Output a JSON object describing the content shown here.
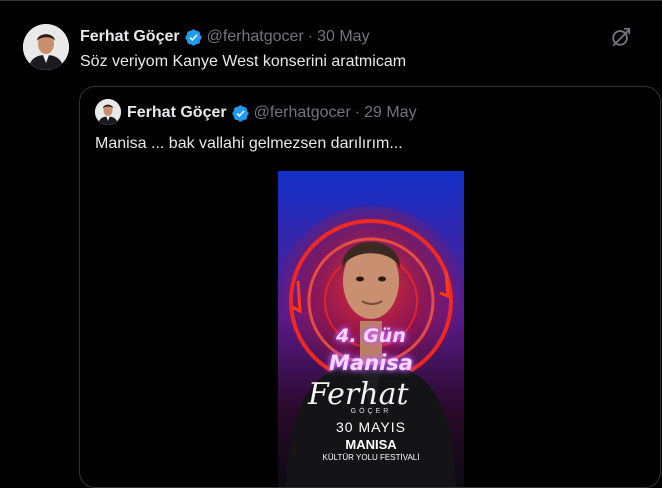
{
  "tweet": {
    "author_name": "Ferhat Göçer",
    "handle": "@ferhatgocer",
    "separator": "·",
    "date": "30 May",
    "text": "Söz veriyom Kanye West konserini aratmicam",
    "grok_icon": "grok-icon"
  },
  "quote": {
    "author_name": "Ferhat Göçer",
    "handle": "@ferhatgocer",
    "separator": "·",
    "date": "29 May",
    "text": "Manisa ... bak vallahi gelmezsen darılırım...",
    "poster": {
      "line1": "4. Gün",
      "line2": "Manisa",
      "signature": "Ferhat",
      "subsig": "GÖÇER",
      "date": "30 MAYIS",
      "city": "MANISA",
      "festival": "KÜLTÜR YOLU FESTİVALİ"
    }
  },
  "colors": {
    "verified": "#1d9bf0",
    "muted": "#71767b",
    "border": "#2f3336",
    "neon_purple": "#c060ff",
    "poster_red": "#e0201c"
  }
}
